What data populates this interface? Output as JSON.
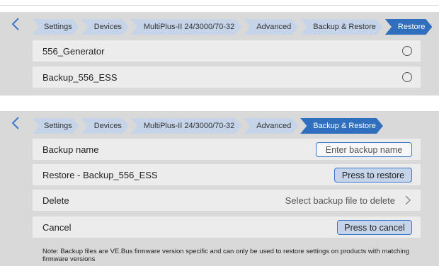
{
  "top": {
    "breadcrumb": [
      "Settings",
      "Devices",
      "MultiPlus-II 24/3000/70-32",
      "Advanced",
      "Backup & Restore",
      "Restore"
    ],
    "files": [
      {
        "name": "556_Generator"
      },
      {
        "name": "Backup_556_ESS"
      }
    ]
  },
  "bottom": {
    "breadcrumb": [
      "Settings",
      "Devices",
      "MultiPlus-II 24/3000/70-32",
      "Advanced",
      "Backup & Restore"
    ],
    "backup_name_label": "Backup name",
    "backup_name_placeholder": "Enter backup name",
    "restore_label": "Restore - Backup_556_ESS",
    "restore_button": "Press to restore",
    "delete_label": "Delete",
    "delete_value": "Select backup file to delete",
    "cancel_label": "Cancel",
    "cancel_button": "Press to cancel",
    "note": "Note: Backup files are VE.Bus firmware version specific and can only be used to restore settings on products with matching firmware versions"
  },
  "colors": {
    "accent": "#2f6fbd",
    "crumb_bg": "#c5d4e8",
    "panel_bg": "#d9d9d9",
    "row_bg": "#ececec"
  },
  "icons": {
    "back": "chevron-left-icon",
    "forward": "chevron-right-icon",
    "radio": "radio-unchecked-icon"
  }
}
